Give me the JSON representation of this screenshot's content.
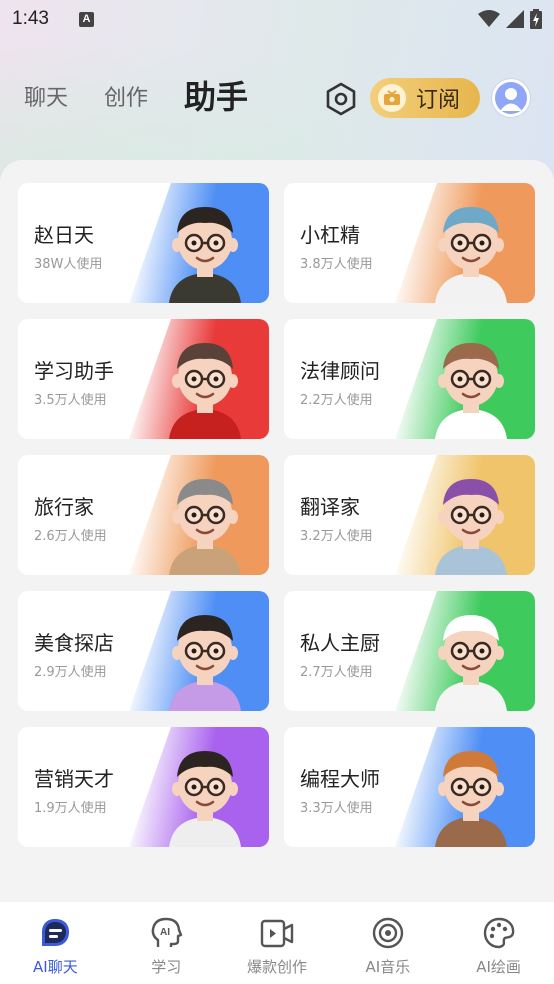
{
  "status": {
    "time": "1:43",
    "notif": "A"
  },
  "header": {
    "tabs": [
      {
        "label": "聊天"
      },
      {
        "label": "创作"
      },
      {
        "label": "助手"
      }
    ],
    "subscribe_label": "订阅"
  },
  "cards": [
    {
      "title": "赵日天",
      "usage": "38W人使用",
      "accent": "#4f8ff5"
    },
    {
      "title": "小杠精",
      "usage": "3.8万人使用",
      "accent": "#ef9a5c"
    },
    {
      "title": "学习助手",
      "usage": "3.5万人使用",
      "accent": "#e93a3a"
    },
    {
      "title": "法律顾问",
      "usage": "2.2万人使用",
      "accent": "#3fca5e"
    },
    {
      "title": "旅行家",
      "usage": "2.6万人使用",
      "accent": "#ef9a5c"
    },
    {
      "title": "翻译家",
      "usage": "3.2万人使用",
      "accent": "#f0c46a"
    },
    {
      "title": "美食探店",
      "usage": "2.9万人使用",
      "accent": "#4f8ff5"
    },
    {
      "title": "私人主厨",
      "usage": "2.7万人使用",
      "accent": "#3fca5e"
    },
    {
      "title": "营销天才",
      "usage": "1.9万人使用",
      "accent": "#a862ee"
    },
    {
      "title": "编程大师",
      "usage": "3.3万人使用",
      "accent": "#4f8ff5"
    }
  ],
  "bottom_nav": [
    {
      "label": "AI聊天",
      "icon": "chat-icon"
    },
    {
      "label": "学习",
      "icon": "ai-head-icon"
    },
    {
      "label": "爆款创作",
      "icon": "video-icon"
    },
    {
      "label": "AI音乐",
      "icon": "music-disc-icon"
    },
    {
      "label": "AI绘画",
      "icon": "palette-icon"
    }
  ],
  "colors": {
    "accent_blue": "#3b5bdb",
    "subscribe_gold": "#e6b64c"
  }
}
